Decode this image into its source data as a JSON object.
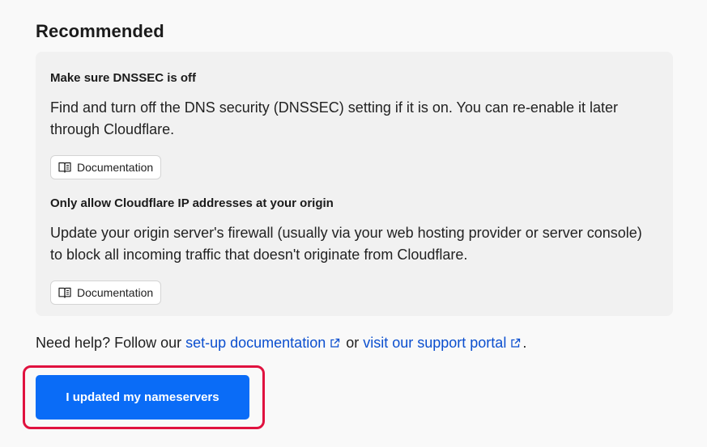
{
  "section": {
    "title": "Recommended"
  },
  "recommendations": [
    {
      "title": "Make sure DNSSEC is off",
      "body": "Find and turn off the DNS security (DNSSEC) setting if it is on. You can re-enable it later through Cloudflare.",
      "button_label": "Documentation",
      "button_icon": "book-icon"
    },
    {
      "title": "Only allow Cloudflare IP addresses at your origin",
      "body": "Update your origin server's firewall (usually via your web hosting provider or server console) to block all incoming traffic that doesn't originate from Cloudflare.",
      "button_label": "Documentation",
      "button_icon": "book-icon"
    }
  ],
  "help": {
    "prefix": "Need help? Follow our ",
    "link1": "set-up documentation",
    "middle": " or ",
    "link2": "visit our support portal",
    "suffix": ".",
    "link_icon": "external-link-icon",
    "link_color": "#0b4fcf"
  },
  "primary_action": {
    "label": "I updated my nameservers",
    "color": "#0a6cf7",
    "highlight_color": "#e0123f"
  }
}
